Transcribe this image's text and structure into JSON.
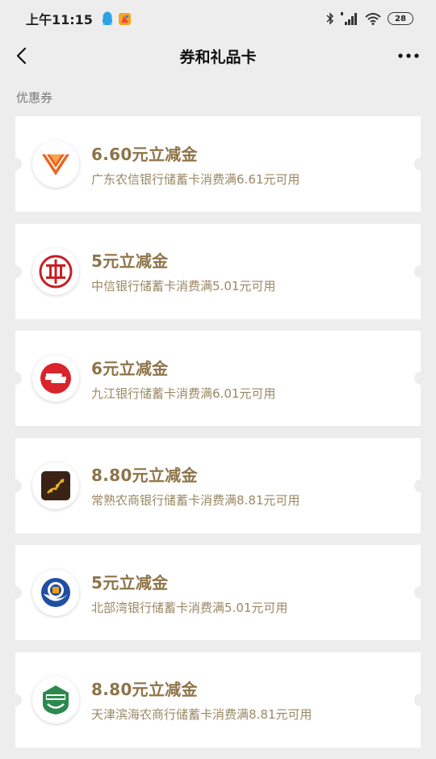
{
  "status_bar": {
    "time": "上午11:15",
    "battery": "28"
  },
  "header": {
    "title": "券和礼品卡"
  },
  "section": {
    "label": "优惠券"
  },
  "coupons": [
    {
      "amount": "6.60元立减金",
      "desc": "广东农信银行储蓄卡消费满6.61元可用",
      "logo": "guangdong-rural-credit-logo",
      "color": "#e8651f"
    },
    {
      "amount": "5元立减金",
      "desc": "中信银行储蓄卡消费满5.01元可用",
      "logo": "citic-bank-logo",
      "color": "#c81e24"
    },
    {
      "amount": "6元立减金",
      "desc": "九江银行储蓄卡消费满6.01元可用",
      "logo": "jiujiang-bank-logo",
      "color": "#d9242b"
    },
    {
      "amount": "8.80元立减金",
      "desc": "常熟农商银行储蓄卡消费满8.81元可用",
      "logo": "changshu-rural-bank-logo",
      "color": "#3a2316"
    },
    {
      "amount": "5元立减金",
      "desc": "北部湾银行储蓄卡消费满5.01元可用",
      "logo": "beibu-gulf-bank-logo",
      "color": "#1f4fa3"
    },
    {
      "amount": "8.80元立减金",
      "desc": "天津滨海农商行储蓄卡消费满8.81元可用",
      "logo": "tianjin-binhai-rural-bank-logo",
      "color": "#2d8a4e"
    }
  ],
  "colors": {
    "background": "#ededed",
    "amount": "#8e7449",
    "description": "#9b8865"
  }
}
